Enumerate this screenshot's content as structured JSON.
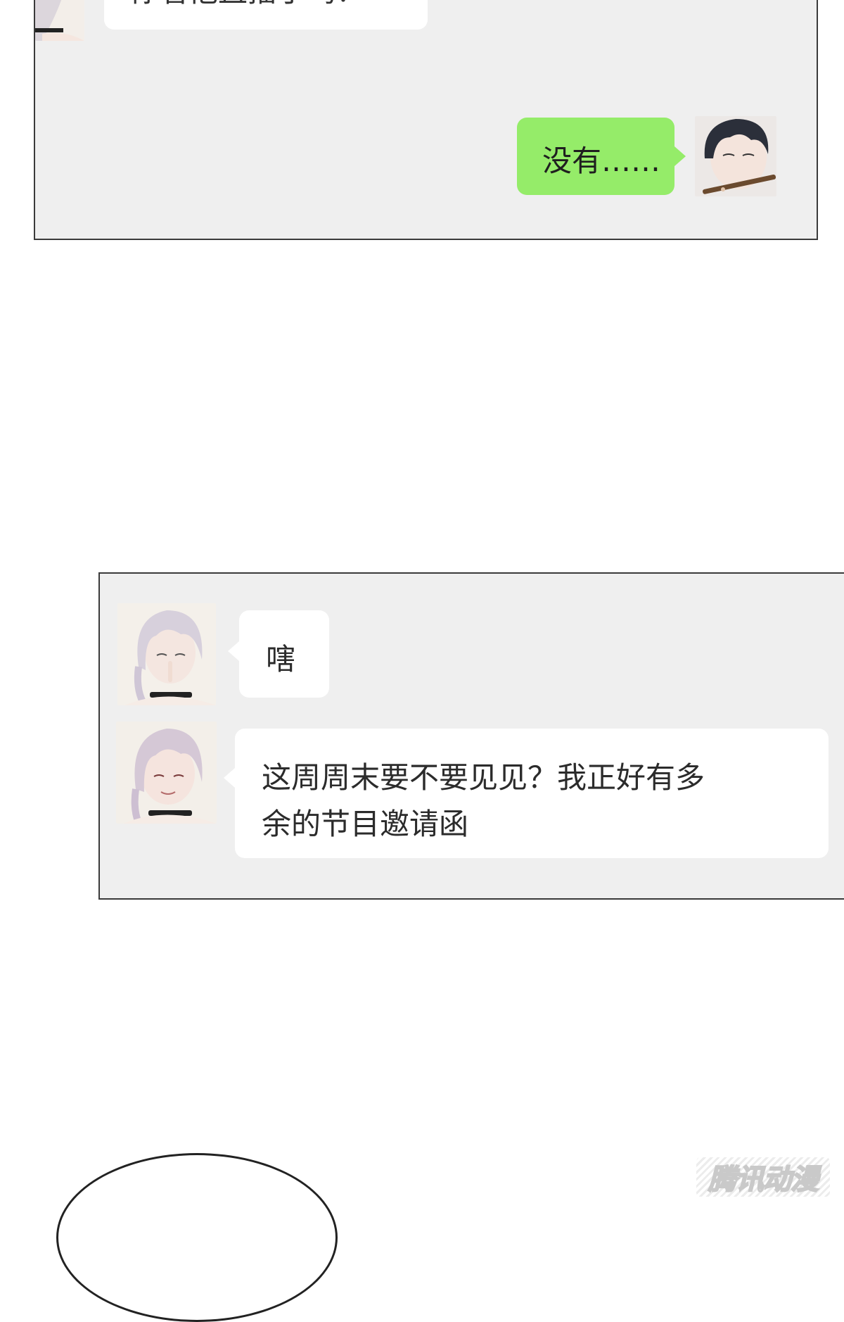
{
  "panels": [
    {
      "messages": [
        {
          "sender": "other",
          "text": "你看他直播了吗？",
          "avatar": "silver-hair-avatar"
        },
        {
          "sender": "self",
          "text": "没有……",
          "avatar": "dark-hair-flute-avatar"
        }
      ]
    },
    {
      "messages": [
        {
          "sender": "other",
          "text": "嗐",
          "avatar": "silver-hair-shush-avatar"
        },
        {
          "sender": "other",
          "line1": "这周周末要不要见见？我正好有多",
          "line2": "余的节目邀请函",
          "avatar": "silver-hair-smile-avatar"
        }
      ]
    }
  ],
  "watermark": "腾讯动漫",
  "colors": {
    "panel_bg": "#efefef",
    "self_bubble": "#95ec69",
    "other_bubble": "#ffffff",
    "border": "#3a3a3a"
  }
}
